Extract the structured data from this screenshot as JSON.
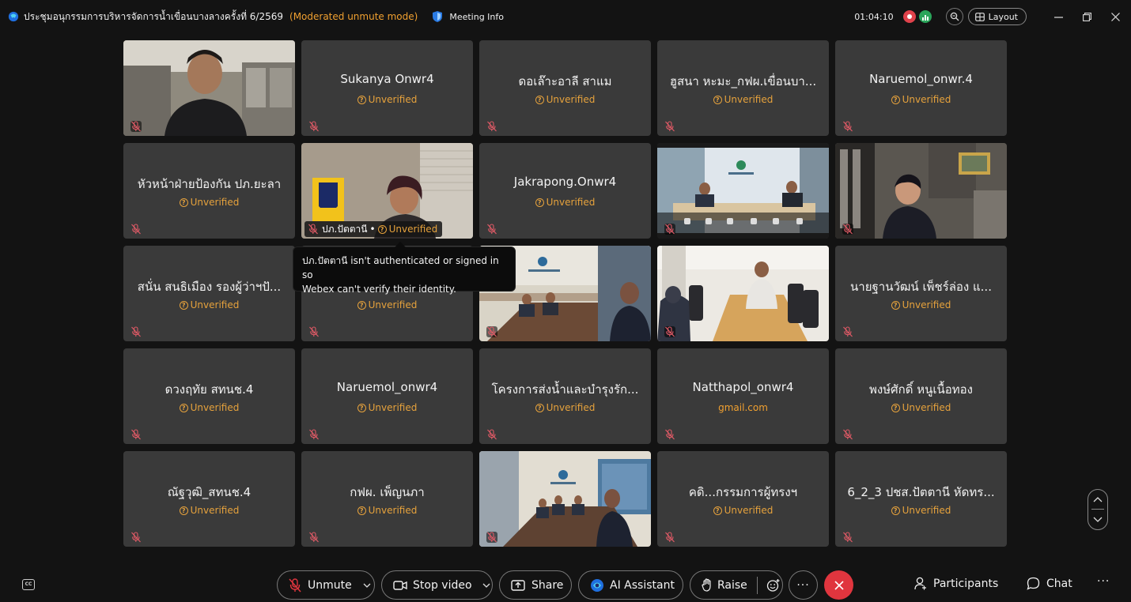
{
  "titlebar": {
    "meeting_title": "ประชุมอนุกรรมการบริหารจัดการน้ำเขื่อนบางลางครั้งที่ 6/2569",
    "mode": "(Moderated unmute mode)",
    "meeting_info": "Meeting Info",
    "timer": "01:04:10",
    "layout_label": "Layout"
  },
  "colors": {
    "accent_warning": "#e6a23c",
    "leave_red": "#e0353e",
    "record_red": "#e0424b",
    "stats_green": "#2aa55a",
    "tile_bg": "#3a3a3a"
  },
  "unverified_label": "Unverified",
  "tiles": [
    {
      "type": "video",
      "scene": "man-office"
    },
    {
      "type": "name",
      "name": "Sukanya Onwr4",
      "status": "Unverified"
    },
    {
      "type": "name",
      "name": "ดอเล๊าะอาลี สาแม",
      "status": "Unverified"
    },
    {
      "type": "name",
      "name": "ฮูสนา หะมะ_กฟผ.เขื่อนบา...",
      "status": "Unverified"
    },
    {
      "type": "name",
      "name": "Naruemol_onwr.4",
      "status": "Unverified"
    },
    {
      "type": "name",
      "name": "หัวหน้าฝ่ายป้องกัน ปภ.ยะลา",
      "status": "Unverified"
    },
    {
      "type": "video",
      "scene": "woman-office",
      "label": "ปภ.ปัตตานี",
      "status": "Unverified"
    },
    {
      "type": "name",
      "name": "Jakrapong.Onwr4",
      "status": "Unverified"
    },
    {
      "type": "video",
      "scene": "meeting-room-phone"
    },
    {
      "type": "video",
      "scene": "man-desk"
    },
    {
      "type": "name",
      "name": "สนั่น สนธิเมือง รองผู้ว่าฯปั...",
      "status": "Unverified"
    },
    {
      "type": "name",
      "name": "",
      "status": "Unverified"
    },
    {
      "type": "video",
      "scene": "conference-room"
    },
    {
      "type": "video",
      "scene": "signing-table"
    },
    {
      "type": "name",
      "name": "นายฐานวัฒน์ เพ็ชร์ล่อง แ...",
      "status": "Unverified"
    },
    {
      "type": "name",
      "name": "ดวงฤทัย สทนช.4",
      "status": "Unverified"
    },
    {
      "type": "name",
      "name": "Naruemol_onwr4",
      "status": "Unverified"
    },
    {
      "type": "name",
      "name": "โครงการส่งน้ำและบำรุงรัก...",
      "status": "Unverified"
    },
    {
      "type": "name",
      "name": "Natthapol_onwr4",
      "status": "gmail.com"
    },
    {
      "type": "name",
      "name": "พงษ์ศักดิ์ หนูเนื้อทอง",
      "status": "Unverified"
    },
    {
      "type": "name",
      "name": "ณัฐวุฒิ_สทนช.4",
      "status": "Unverified"
    },
    {
      "type": "name",
      "name": "กฟผ. เพ็ญนภา",
      "status": "Unverified"
    },
    {
      "type": "video",
      "scene": "conference-room-2"
    },
    {
      "type": "name",
      "name": "คดิ...กรรมการผู้ทรงฯ",
      "status": "Unverified"
    },
    {
      "type": "name",
      "name": "6_2_3 ปชส.ปัตตานี หัดทร...",
      "status": "Unverified"
    }
  ],
  "tooltip": {
    "line1": "ปภ.ปัตตานี isn't authenticated or signed in so",
    "line2": "Webex can't verify their identity."
  },
  "controls": {
    "unmute": "Unmute",
    "stop_video": "Stop video",
    "share": "Share",
    "ai_assistant": "AI Assistant",
    "raise": "Raise",
    "participants": "Participants",
    "chat": "Chat"
  }
}
